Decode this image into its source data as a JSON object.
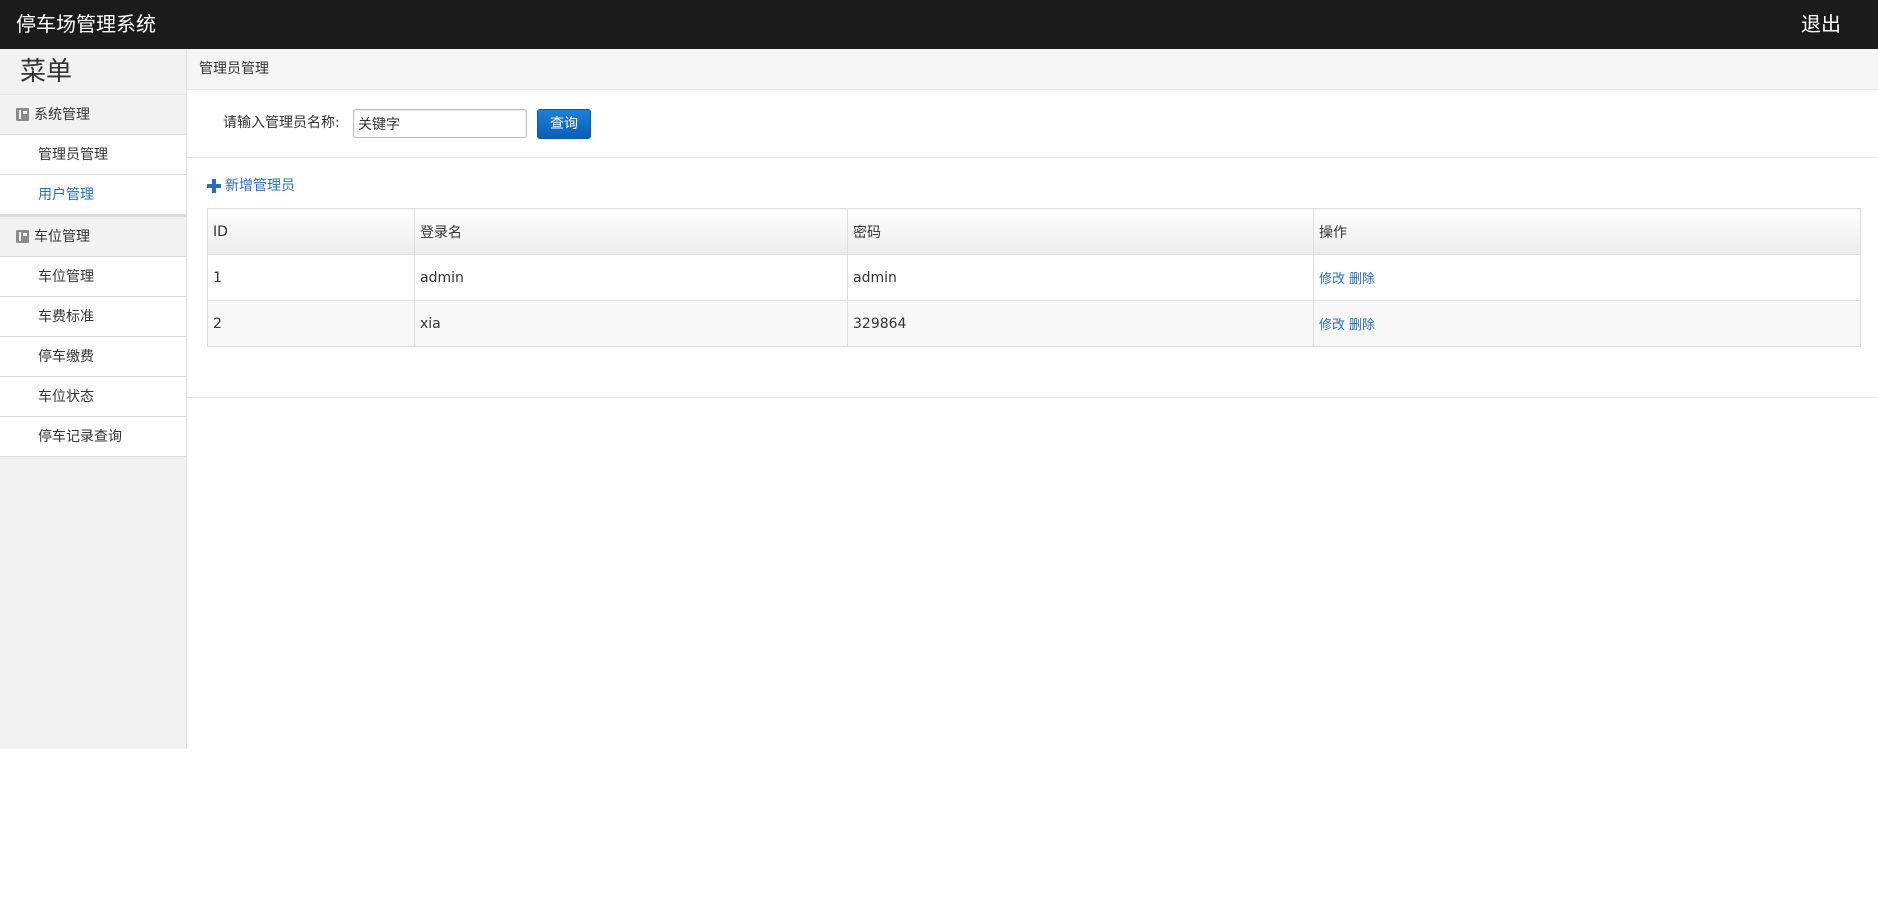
{
  "header": {
    "app_title": "停车场管理系统",
    "logout_label": "退出"
  },
  "sidebar": {
    "menu_title": "菜单",
    "groups": [
      {
        "label": "系统管理",
        "icon": "book-icon",
        "items": [
          {
            "label": "管理员管理",
            "active": false
          },
          {
            "label": "用户管理",
            "active": true
          }
        ]
      },
      {
        "label": "车位管理",
        "icon": "book-icon",
        "items": [
          {
            "label": "车位管理",
            "active": false
          },
          {
            "label": "车费标准",
            "active": false
          },
          {
            "label": "停车缴费",
            "active": false
          },
          {
            "label": "车位状态",
            "active": false
          },
          {
            "label": "停车记录查询",
            "active": false
          }
        ]
      }
    ]
  },
  "main": {
    "breadcrumb": "管理员管理",
    "search": {
      "label": "请输入管理员名称:",
      "value": "关键字",
      "button_label": "查询"
    },
    "add_link_label": "新增管理员",
    "table": {
      "headers": [
        "ID",
        "登录名",
        "密码",
        "操作"
      ],
      "rows": [
        {
          "id": "1",
          "login": "admin",
          "password": "admin",
          "edit": "修改",
          "delete": "删除"
        },
        {
          "id": "2",
          "login": "xia",
          "password": "329864",
          "edit": "修改",
          "delete": "删除"
        }
      ]
    }
  },
  "colors": {
    "header_bg": "#1b1b1b",
    "sidebar_bg": "#f2f2f2",
    "link": "#2a6ebb",
    "primary_button": "#0a5fb4"
  }
}
